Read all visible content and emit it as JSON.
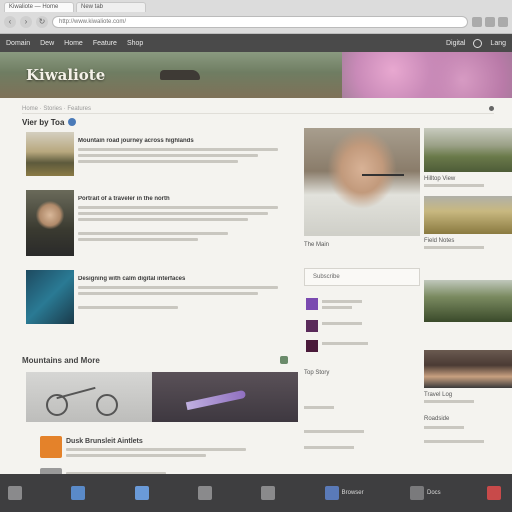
{
  "browser": {
    "tabs": [
      {
        "label": "Kiwaliote — Home",
        "active": true
      },
      {
        "label": "New tab",
        "active": false
      }
    ],
    "url": "http://www.kiwaliote.com/"
  },
  "site_nav": {
    "items": [
      "Domain",
      "Dew",
      "Home",
      "Feature",
      "Shop"
    ],
    "right_items": [
      "Digital",
      "Lang"
    ]
  },
  "hero": {
    "logo": "Kiwaliote"
  },
  "content": {
    "sub_bar_text": "Home · Stories · Features",
    "section_title": "Vier by Toa",
    "articles": [
      {
        "title": "Mountain road journey across highlands",
        "thumb": "mountain"
      },
      {
        "title": "Portrait of a traveler in the north",
        "thumb": "person"
      },
      {
        "title": "Designing with calm digital interfaces",
        "thumb": "teal"
      }
    ],
    "feature_title": "Mountains and More",
    "list_items": [
      {
        "title": "Dusk Brunsleit Aintlets",
        "color": "#e4822a"
      },
      {
        "title": "",
        "color": "#9a9a9a"
      }
    ]
  },
  "mid": {
    "label1": "The Main",
    "box_text": "Subscribe",
    "label2": "Top Story"
  },
  "right": {
    "labels": [
      "Hilltop View",
      "Field Notes",
      "Travel Log",
      "Roadside"
    ]
  },
  "taskbar": {
    "items": [
      "",
      "",
      "",
      "",
      "",
      "Browser",
      "Docs",
      ""
    ]
  },
  "colors": {
    "nav": "#4a4a4a",
    "accent_orange": "#e4822a",
    "accent_purple": "#7a4ab0"
  }
}
